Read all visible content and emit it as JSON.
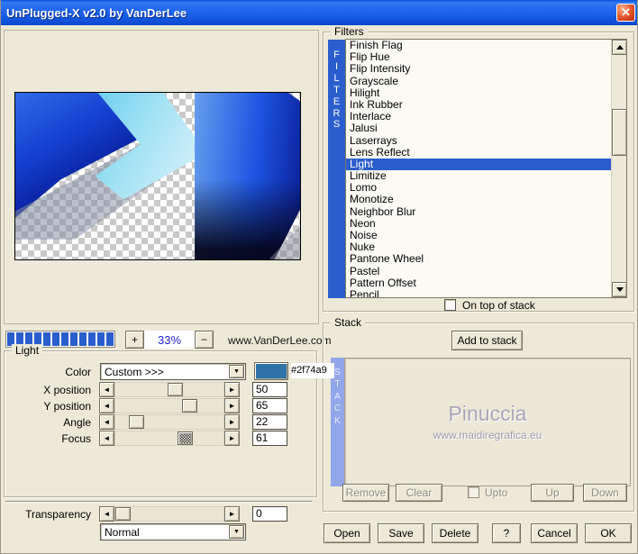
{
  "window": {
    "title": "UnPlugged-X v2.0 by VanDerLee",
    "close_glyph": "✕"
  },
  "preview": {
    "zoom_in_label": "+",
    "zoom_out_label": "−",
    "zoom_percent": "33%",
    "website": "www.VanDerLee.com"
  },
  "light": {
    "group_label": "Light",
    "color_label": "Color",
    "color_value": "Custom >>>",
    "color_hex": "#2f74a9",
    "sliders": [
      {
        "label": "X position",
        "value": "50",
        "pos_pct": 55
      },
      {
        "label": "Y position",
        "value": "65",
        "pos_pct": 70
      },
      {
        "label": "Angle",
        "value": "22",
        "pos_pct": 14
      },
      {
        "label": "Focus",
        "value": "61",
        "pos_pct": 66
      }
    ]
  },
  "transparency": {
    "label": "Transparency",
    "value": "0",
    "pos_pct": 0,
    "blend_mode": "Normal"
  },
  "filters": {
    "group_label": "Filters",
    "sidebar_letters": "FILTERS",
    "items": [
      "Finish Flag",
      "Flip Hue",
      "Flip Intensity",
      "Grayscale",
      "Hilight",
      "Ink Rubber",
      "Interlace",
      "Jalusi",
      "Laserrays",
      "Lens Reflect",
      "Light",
      "Limitize",
      "Lomo",
      "Monotize",
      "Neighbor Blur",
      "Neon",
      "Noise",
      "Nuke",
      "Pantone Wheel",
      "Pastel",
      "Pattern Offset",
      "Pencil"
    ],
    "selected": "Light",
    "on_top_label": "On top of stack"
  },
  "stack": {
    "group_label": "Stack",
    "add_button": "Add to stack",
    "sidebar_letters": "STACK",
    "watermark_title": "Pinuccia",
    "watermark_url": "www.maidiregrafica.eu",
    "remove_button": "Remove",
    "clear_button": "Clear",
    "upto_label": "Upto",
    "up_button": "Up",
    "down_button": "Down"
  },
  "footer": {
    "open": "Open",
    "save": "Save",
    "delete": "Delete",
    "help": "?",
    "cancel": "Cancel",
    "ok": "OK"
  },
  "colors": {
    "accent_blue": "#2b5ecd",
    "stack_bar": "#91a7e9",
    "swatch": "#2f74a9"
  }
}
